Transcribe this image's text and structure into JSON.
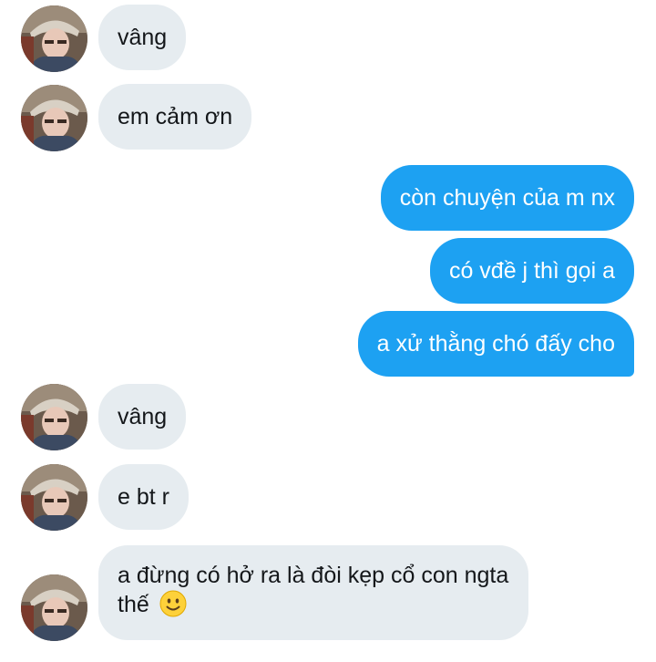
{
  "messages": [
    {
      "side": "incoming",
      "text": "vâng"
    },
    {
      "side": "incoming",
      "text": "em cảm ơn"
    },
    {
      "side": "outgoing",
      "text": "còn chuyện của m nx"
    },
    {
      "side": "outgoing",
      "text": "có vđề j thì gọi a"
    },
    {
      "side": "outgoing",
      "text": "a xử thằng chó đấy cho"
    },
    {
      "side": "incoming",
      "text": "vâng"
    },
    {
      "side": "incoming",
      "text": "e bt r"
    },
    {
      "side": "incoming",
      "text": "a đừng có hở ra là đòi kẹp cổ con ngta thế",
      "emoji": "slightly-smiling-face-icon"
    }
  ],
  "colors": {
    "incoming_bubble": "#e6ecf0",
    "outgoing_bubble": "#1da1f2",
    "incoming_text": "#14171a",
    "outgoing_text": "#ffffff"
  }
}
